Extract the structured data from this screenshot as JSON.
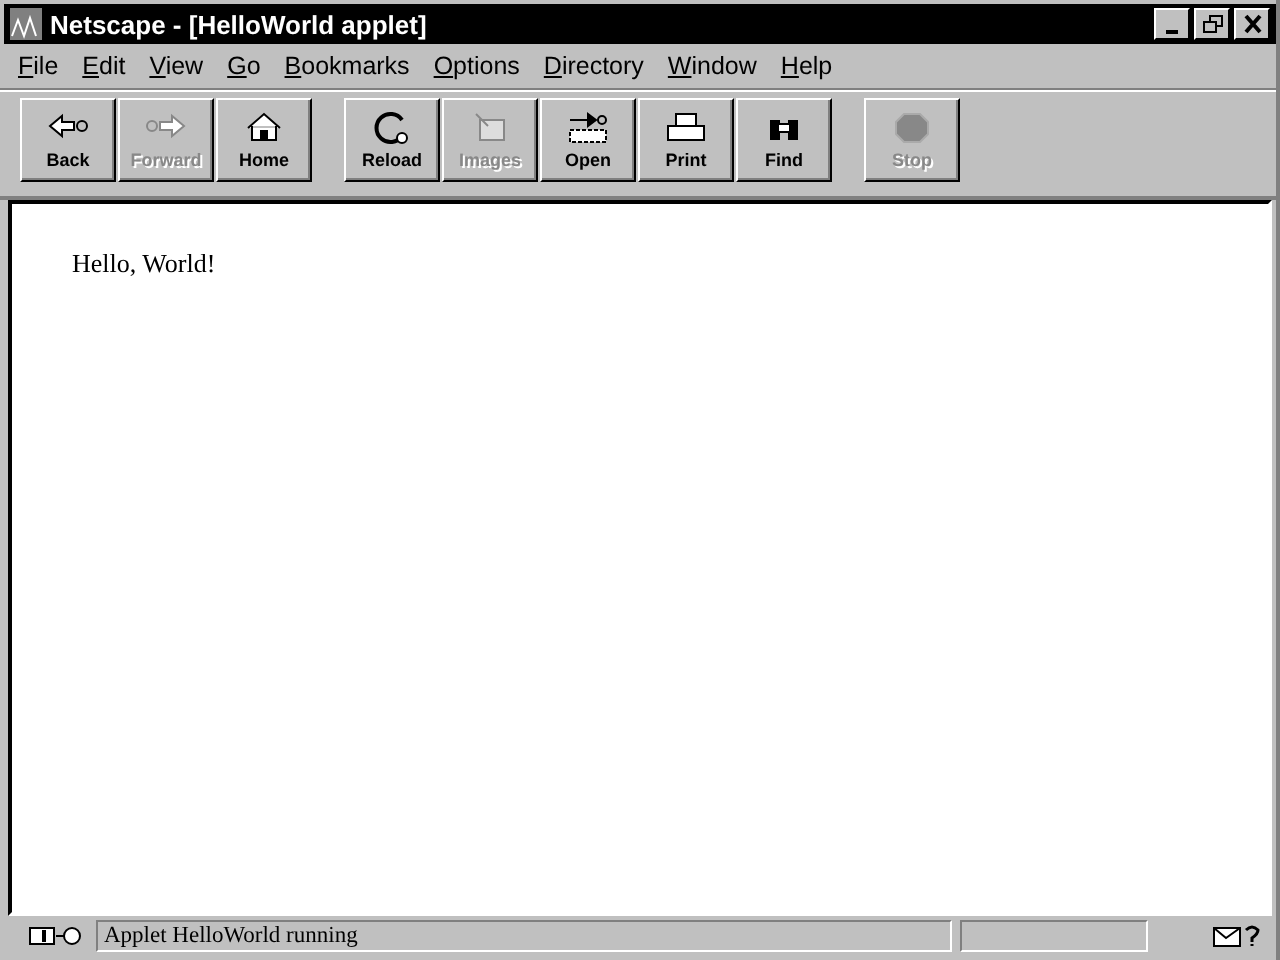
{
  "window": {
    "title": "Netscape - [HelloWorld applet]"
  },
  "menu": [
    {
      "label": "File"
    },
    {
      "label": "Edit"
    },
    {
      "label": "View"
    },
    {
      "label": "Go"
    },
    {
      "label": "Bookmarks"
    },
    {
      "label": "Options"
    },
    {
      "label": "Directory"
    },
    {
      "label": "Window"
    },
    {
      "label": "Help"
    }
  ],
  "toolbar_groups": [
    [
      {
        "label": "Back",
        "kind": "back",
        "disabled": false
      },
      {
        "label": "Forward",
        "kind": "forward",
        "disabled": true
      },
      {
        "label": "Home",
        "kind": "home",
        "disabled": false
      }
    ],
    [
      {
        "label": "Reload",
        "kind": "reload",
        "disabled": false
      },
      {
        "label": "Images",
        "kind": "images",
        "disabled": true
      },
      {
        "label": "Open",
        "kind": "open",
        "disabled": false
      },
      {
        "label": "Print",
        "kind": "print",
        "disabled": false
      },
      {
        "label": "Find",
        "kind": "find",
        "disabled": false
      }
    ],
    [
      {
        "label": "Stop",
        "kind": "stop",
        "disabled": true
      }
    ]
  ],
  "content": {
    "text": "Hello, World!"
  },
  "status_bar": {
    "message": "Applet HelloWorld running"
  }
}
